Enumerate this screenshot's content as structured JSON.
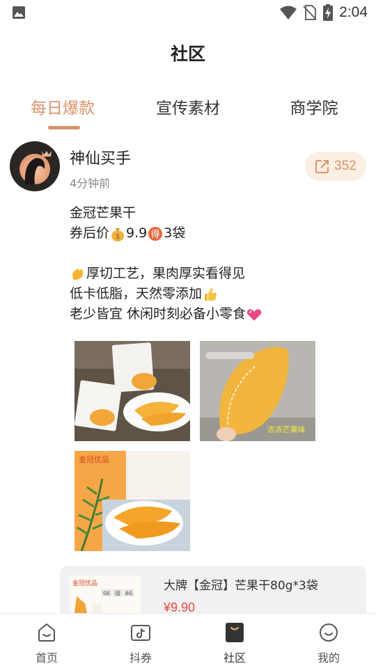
{
  "status_bar": {
    "time": "2:04",
    "icons": [
      "gallery-icon",
      "wifi-icon",
      "no-sim-icon",
      "battery-charging-icon"
    ]
  },
  "header": {
    "title": "社区"
  },
  "tabs": [
    {
      "label": "每日爆款",
      "active": true
    },
    {
      "label": "宣传素材",
      "active": false
    },
    {
      "label": "商学院",
      "active": false
    }
  ],
  "post": {
    "author": "神仙买手",
    "time_ago": "4分钟前",
    "share_count": "352",
    "lines": [
      {
        "parts": [
          {
            "text": "金冠芒果干"
          }
        ]
      },
      {
        "parts": [
          {
            "text": "券后价"
          },
          {
            "emoji": "money-bag-emoji"
          },
          {
            "text": "9.9"
          },
          {
            "emoji": "de-badge-emoji"
          },
          {
            "text": "3袋"
          }
        ]
      },
      {
        "parts": []
      },
      {
        "parts": [
          {
            "emoji": "clapping-hands-emoji"
          },
          {
            "text": "厚切工艺，果肉厚实看得见"
          }
        ]
      },
      {
        "parts": [
          {
            "text": "低卡低脂，天然零添加"
          },
          {
            "emoji": "thumbs-up-emoji"
          }
        ]
      },
      {
        "parts": [
          {
            "text": "老少皆宜 休闲时刻必备小零食"
          },
          {
            "emoji": "heart-emoji"
          }
        ]
      }
    ],
    "images": [
      {
        "name": "post-image-1"
      },
      {
        "name": "post-image-2",
        "caption": "浓浓芒果味"
      },
      {
        "name": "post-image-3",
        "brand": "金冠优品"
      }
    ]
  },
  "product": {
    "name": "大牌【金冠】芒果干80g*3袋",
    "price": "¥9.90",
    "thumb_brand": "金冠优品",
    "thumb_badges": [
      "GE",
      "固",
      "BG"
    ]
  },
  "tabbar": [
    {
      "label": "首页",
      "icon": "home-icon",
      "active": false
    },
    {
      "label": "抖券",
      "icon": "douyin-coupon-icon",
      "active": false
    },
    {
      "label": "社区",
      "icon": "community-bag-icon",
      "active": true
    },
    {
      "label": "我的",
      "icon": "profile-smile-icon",
      "active": false
    }
  ],
  "colors": {
    "accent": "#d9936a",
    "price_red": "#e8473b",
    "share_bg": "#fbeee3",
    "card_bg": "#f1f1f3"
  }
}
